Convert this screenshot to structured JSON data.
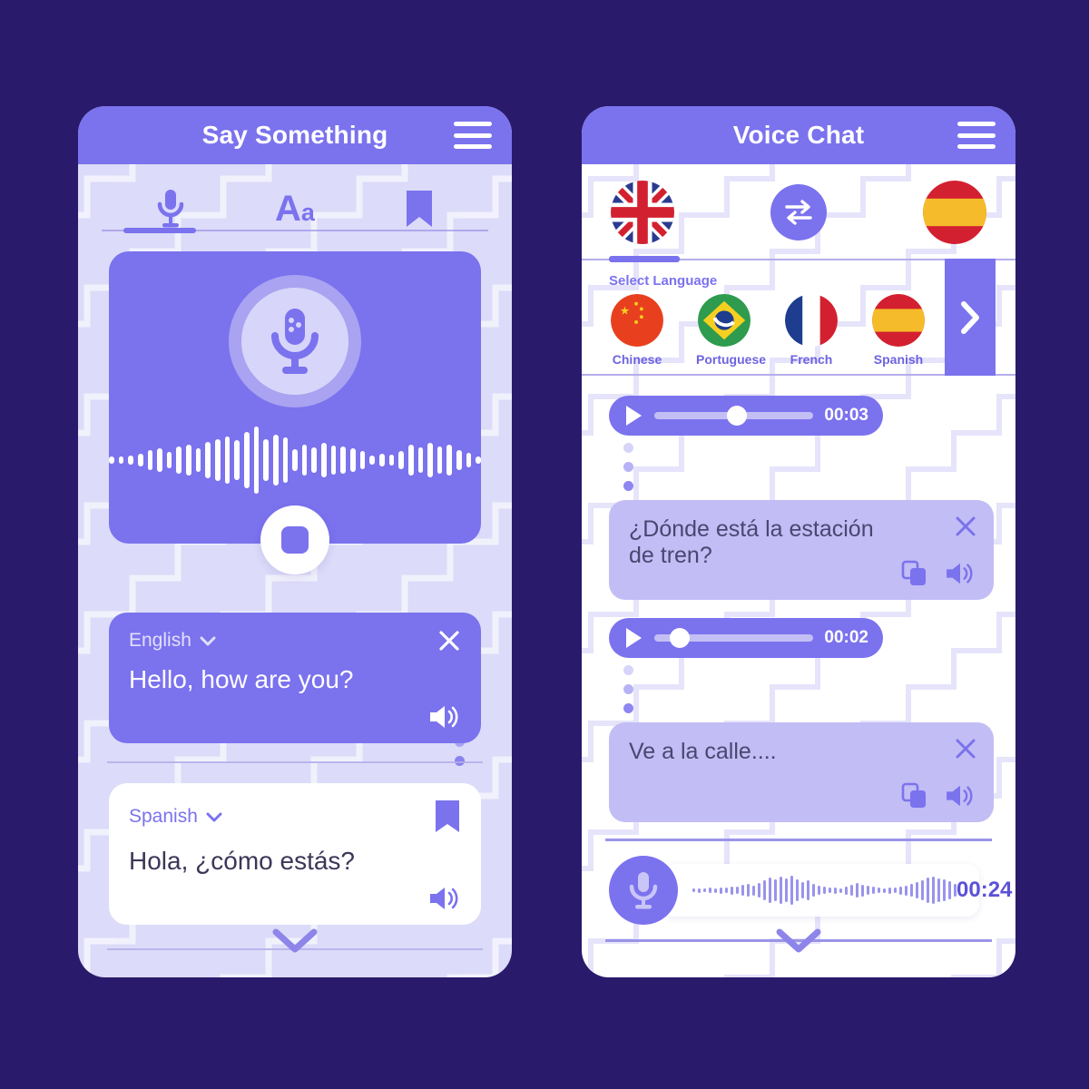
{
  "theme": {
    "page_background": "#2a1a6b",
    "accent": "#7b72ee",
    "accent_light": "#c2bdf5",
    "surface_left": "#dcdbf9",
    "surface_right": "#ffffff",
    "text_dark": "#3b3758"
  },
  "left_screen": {
    "header": {
      "title": "Say Something",
      "menu_icon": "hamburger-icon"
    },
    "tabs": [
      {
        "icon": "microphone-icon",
        "name": "voice-tab",
        "active": true
      },
      {
        "icon": "text-aa-icon",
        "label_big": "A",
        "label_small": "a",
        "name": "text-tab",
        "active": false
      },
      {
        "icon": "bookmark-icon",
        "name": "saved-tab",
        "active": false
      }
    ],
    "recorder": {
      "mic_icon": "microphone-icon",
      "stop_icon": "stop-square-icon",
      "waveform": [
        6,
        8,
        10,
        14,
        22,
        26,
        18,
        30,
        34,
        26,
        40,
        46,
        52,
        44,
        62,
        74,
        46,
        56,
        50,
        24,
        34,
        28,
        38,
        32,
        30,
        26,
        20,
        10,
        14,
        12,
        20,
        34,
        28,
        38,
        30,
        34,
        22,
        16,
        8
      ]
    },
    "source_card": {
      "language": "English",
      "chevron_icon": "chevron-down-icon",
      "close_icon": "close-icon",
      "text": "Hello, how are you?",
      "speaker_icon": "speaker-icon"
    },
    "target_card": {
      "language": "Spanish",
      "chevron_icon": "chevron-down-icon",
      "bookmark_icon": "bookmark-icon",
      "text": "Hola, ¿cómo estás?",
      "speaker_icon": "speaker-icon"
    },
    "footer": {
      "collapse_icon": "chevron-down-icon"
    }
  },
  "right_screen": {
    "header": {
      "title": "Voice Chat",
      "menu_icon": "hamburger-icon"
    },
    "language_bar": {
      "source_flag": "uk-flag",
      "source_flag_label": "United Kingdom",
      "swap_icon": "swap-arrows-icon",
      "target_flag": "spain-flag",
      "target_flag_label": "Spain"
    },
    "language_picker": {
      "label": "Select Language",
      "next_icon": "chevron-right-icon",
      "options": [
        {
          "name": "Chinese",
          "flag": "china-flag"
        },
        {
          "name": "Portuguese",
          "flag": "brazil-flag"
        },
        {
          "name": "French",
          "flag": "france-flag"
        },
        {
          "name": "Spanish",
          "flag": "spain-flag"
        }
      ]
    },
    "messages": [
      {
        "player": {
          "play_icon": "play-icon",
          "time": "00:03",
          "progress": 0.52
        },
        "typing_icon": "three-dots-icon",
        "text": "¿Dónde está la estación de tren?",
        "close_icon": "close-icon",
        "copy_icon": "copy-icon",
        "speaker_icon": "speaker-icon"
      },
      {
        "player": {
          "play_icon": "play-icon",
          "time": "00:02",
          "progress": 0.16
        },
        "typing_icon": "three-dots-icon",
        "text": "Ve a la calle....",
        "close_icon": "close-icon",
        "copy_icon": "copy-icon",
        "speaker_icon": "speaker-icon"
      }
    ],
    "recorder": {
      "mic_icon": "microphone-icon",
      "time": "00:24",
      "waveform": [
        4,
        5,
        4,
        6,
        5,
        7,
        6,
        9,
        8,
        12,
        14,
        11,
        16,
        22,
        28,
        24,
        30,
        26,
        32,
        24,
        18,
        22,
        14,
        10,
        8,
        6,
        7,
        5,
        9,
        12,
        16,
        13,
        10,
        8,
        6,
        5,
        7,
        6,
        9,
        11,
        14,
        18,
        22,
        28,
        30,
        26,
        24,
        20,
        14
      ]
    },
    "footer": {
      "collapse_icon": "chevron-down-icon"
    }
  }
}
